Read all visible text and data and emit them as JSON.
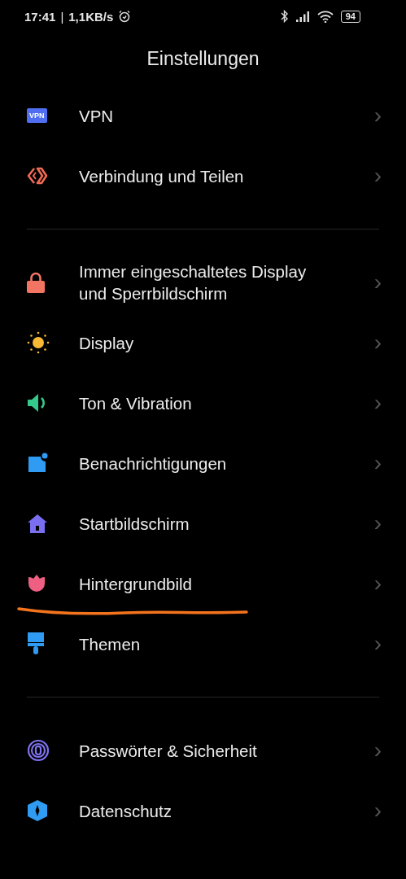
{
  "status_bar": {
    "time": "17:41",
    "separator": "|",
    "speed": "1,1KB/s",
    "battery": "94"
  },
  "title": "Einstellungen",
  "sections": [
    {
      "items": [
        {
          "kind": "vpn",
          "icon_text": "VPN",
          "label": "VPN",
          "chevron": "›"
        },
        {
          "kind": "share",
          "label": "Verbindung und Teilen",
          "chevron": "›"
        }
      ]
    },
    {
      "items": [
        {
          "kind": "lock",
          "label": "Immer eingeschaltetes Display und Sperrbildschirm",
          "chevron": "›"
        },
        {
          "kind": "sun",
          "label": "Display",
          "chevron": "›"
        },
        {
          "kind": "sound",
          "label": "Ton & Vibration",
          "chevron": "›"
        },
        {
          "kind": "notify",
          "label": "Benachrichtigungen",
          "chevron": "›"
        },
        {
          "kind": "home",
          "label": "Startbildschirm",
          "chevron": "›"
        },
        {
          "kind": "tulip",
          "label": "Hintergrundbild",
          "chevron": "›",
          "underlined": true
        },
        {
          "kind": "brush",
          "label": "Themen",
          "chevron": "›"
        }
      ]
    },
    {
      "items": [
        {
          "kind": "fingerprint",
          "label": "Passwörter & Sicherheit",
          "chevron": "›"
        },
        {
          "kind": "shield",
          "label": "Datenschutz",
          "chevron": "›"
        }
      ]
    }
  ]
}
